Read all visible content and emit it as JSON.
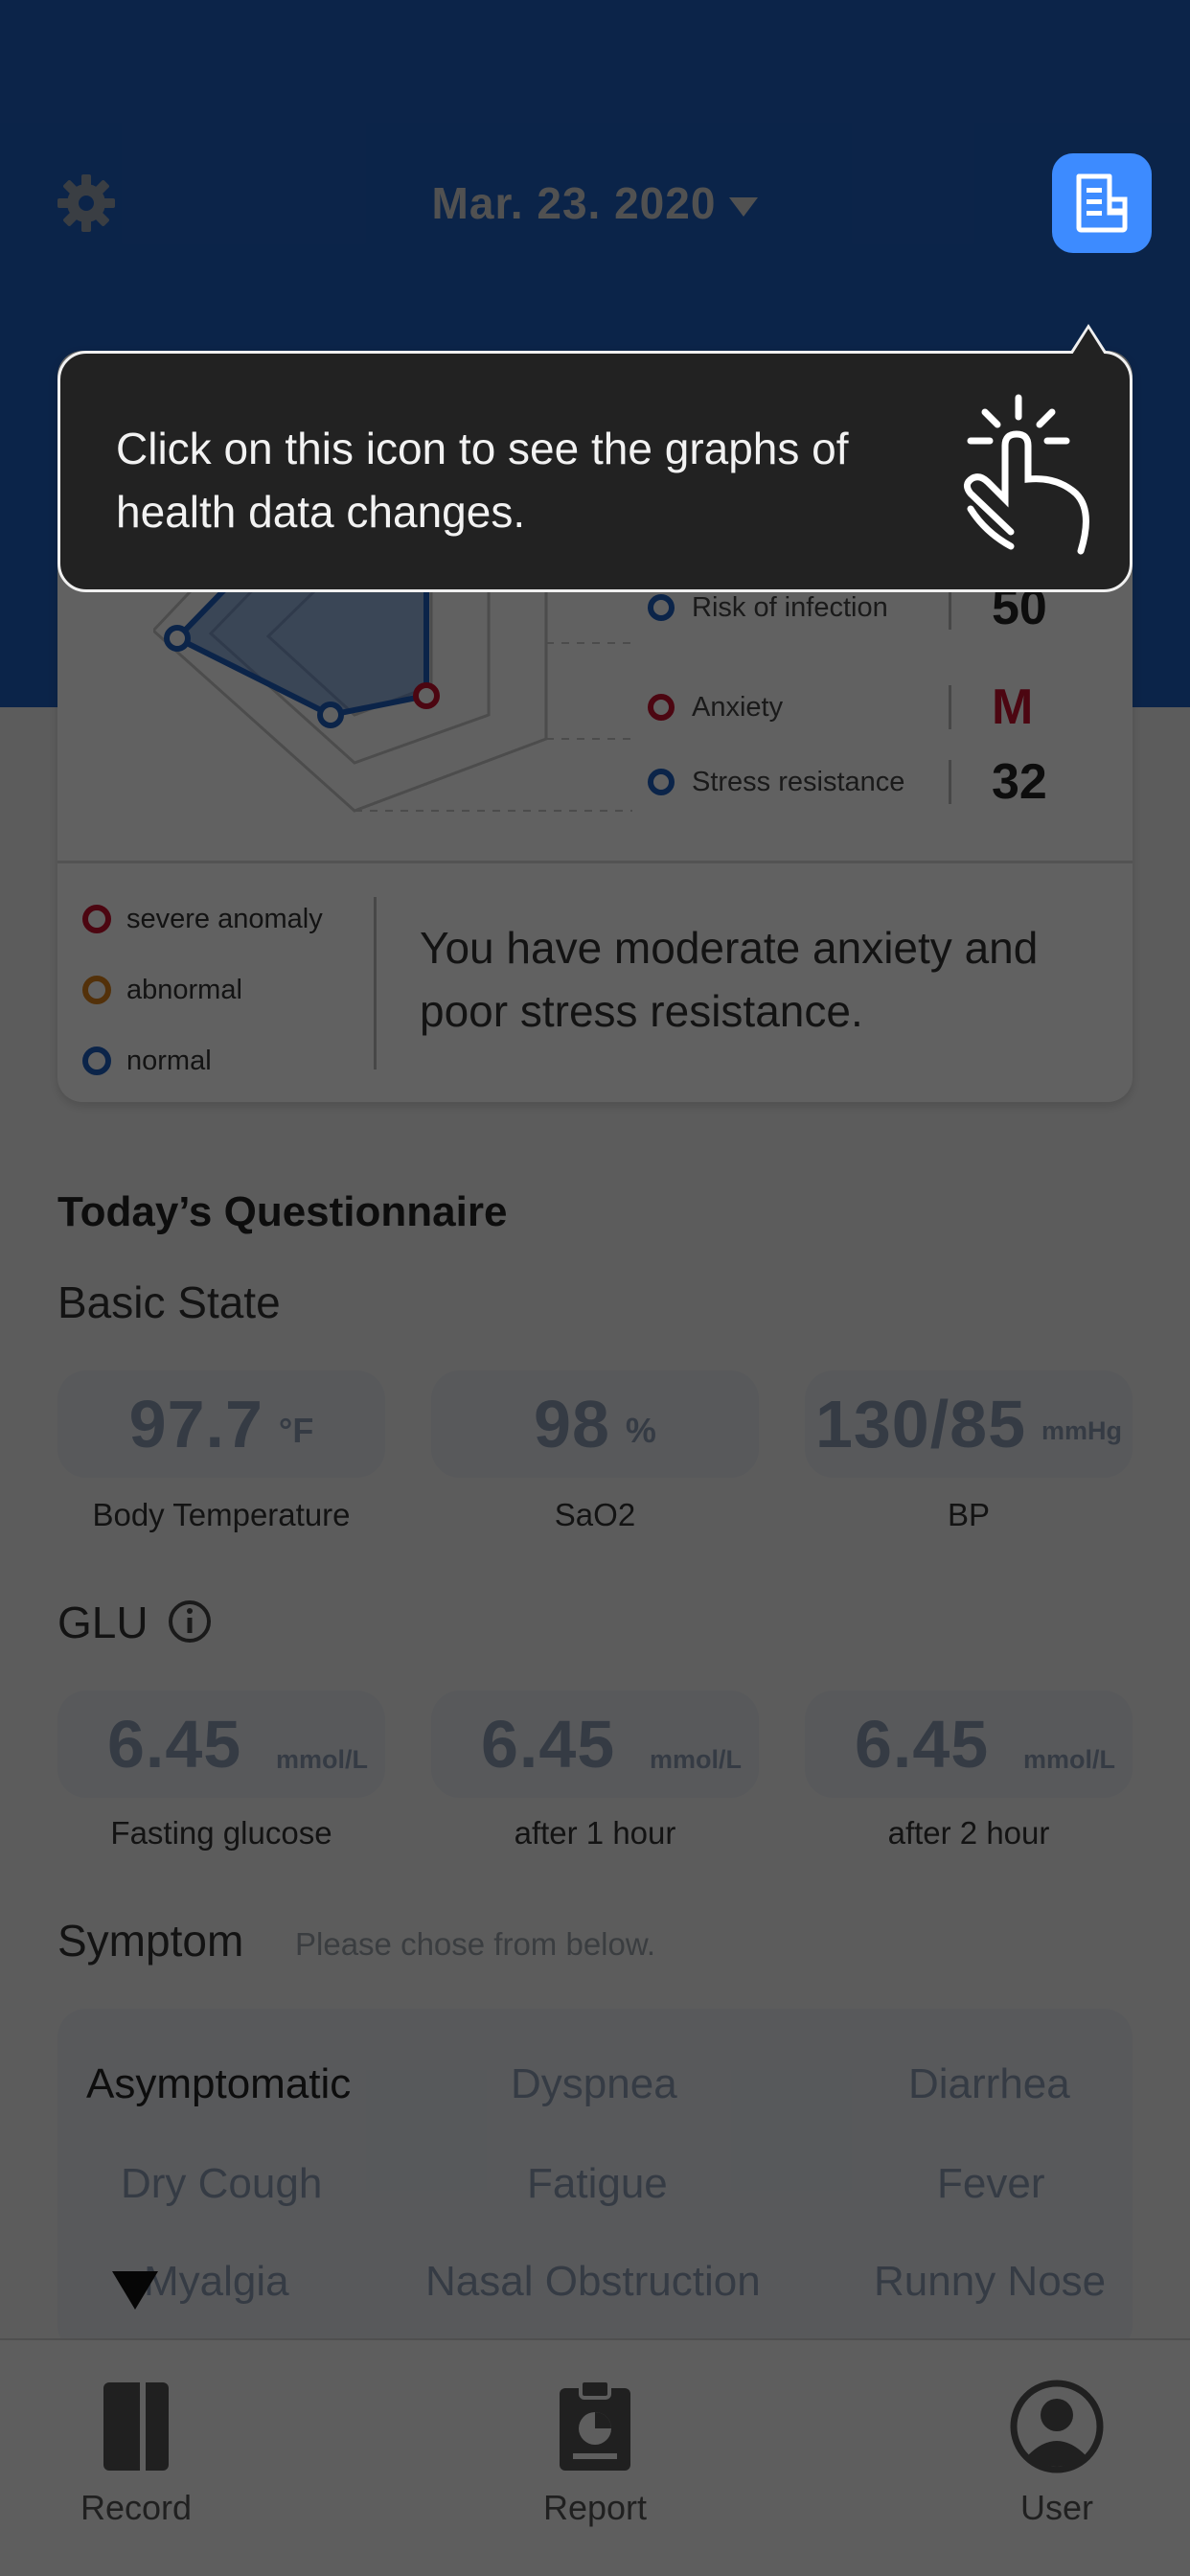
{
  "header": {
    "date": "Mar. 23. 2020",
    "settings_icon": "gear-icon",
    "report_icon": "document-chart-icon"
  },
  "overview": {
    "metrics": [
      {
        "label": "Risk of infection",
        "value": "50",
        "status": "normal"
      },
      {
        "label": "Anxiety",
        "value": "M",
        "status": "severe anomaly"
      },
      {
        "label": "Stress resistance",
        "value": "32",
        "status": "normal"
      }
    ],
    "legend": [
      {
        "label": "severe anomaly",
        "color": "#c8102e"
      },
      {
        "label": "abnormal",
        "color": "#d9821c"
      },
      {
        "label": "normal",
        "color": "#1f5fbf"
      }
    ],
    "summary": "You have moderate anxiety and poor stress resistance."
  },
  "questionnaire": {
    "title": "Today’s Questionnaire",
    "basic_state": {
      "heading": "Basic State",
      "items": [
        {
          "value": "97.7",
          "unit": "°F",
          "label": "Body Temperature"
        },
        {
          "value": "98",
          "unit": "%",
          "label": "SaO2"
        },
        {
          "value": "130/85",
          "unit": "mmHg",
          "label": "BP"
        }
      ]
    },
    "glu": {
      "heading": "GLU",
      "info_icon": "info-icon",
      "items": [
        {
          "value": "6.45",
          "unit": "mmol/L",
          "label": "Fasting glucose"
        },
        {
          "value": "6.45",
          "unit": "mmol/L",
          "label": "after 1 hour"
        },
        {
          "value": "6.45",
          "unit": "mmol/L",
          "label": "after 2 hour"
        }
      ]
    },
    "symptom": {
      "heading": "Symptom",
      "hint": "Please chose from below.",
      "options": [
        {
          "label": "Asymptomatic",
          "selected": true
        },
        {
          "label": "Dyspnea",
          "selected": false
        },
        {
          "label": "Diarrhea",
          "selected": false
        },
        {
          "label": "Dry Cough",
          "selected": false
        },
        {
          "label": "Fatigue",
          "selected": false
        },
        {
          "label": "Fever",
          "selected": false
        },
        {
          "label": "Myalgia",
          "selected": false
        },
        {
          "label": "Nasal Obstruction",
          "selected": false
        },
        {
          "label": "Runny Nose",
          "selected": false
        }
      ]
    }
  },
  "bottom_nav": [
    {
      "label": "Record",
      "icon": "book-icon"
    },
    {
      "label": "Report",
      "icon": "clipboard-chart-icon"
    },
    {
      "label": "User",
      "icon": "user-icon"
    }
  ],
  "tooltip": {
    "text": "Click on this icon to see the graphs of health data changes.",
    "icon": "tap-gesture-icon"
  },
  "colors": {
    "header_blue": "#1f5fbf",
    "accent_blue": "#3d8bff",
    "severe_red": "#c8102e"
  }
}
